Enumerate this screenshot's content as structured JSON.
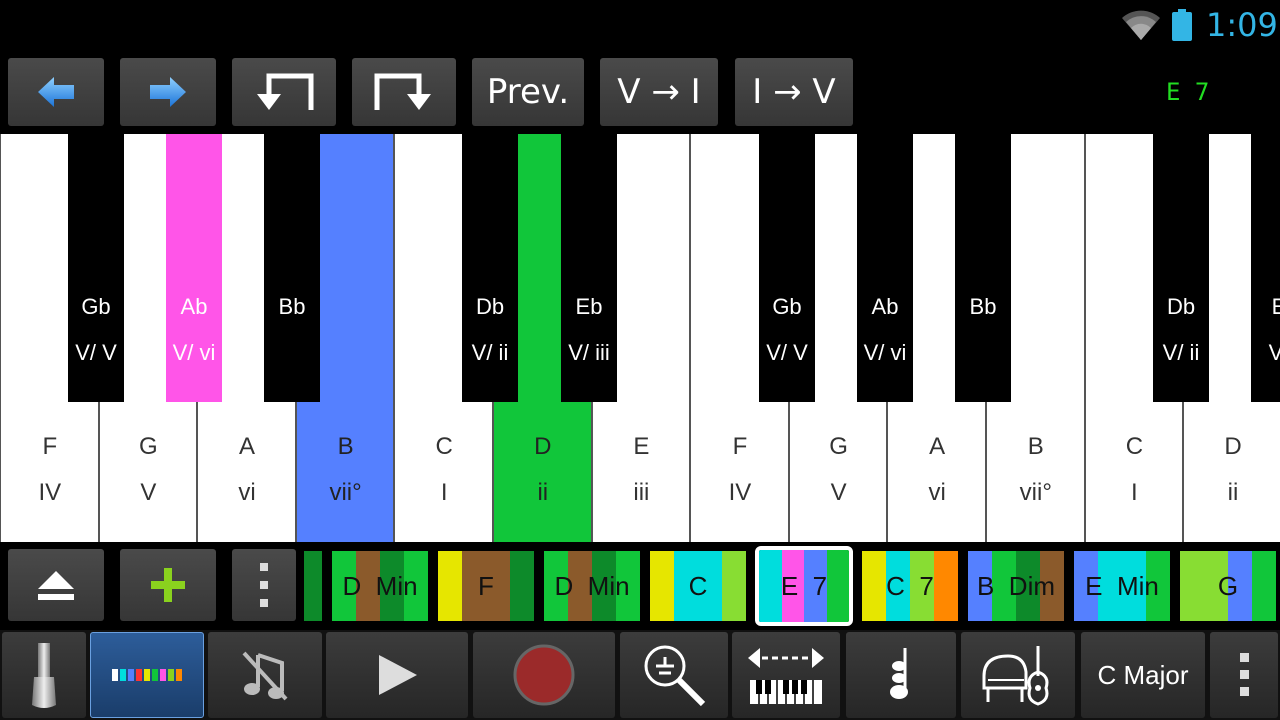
{
  "status": {
    "time": "1:09",
    "wifi_icon": "wifi-icon",
    "battery_icon": "battery-icon",
    "accent": "#33b5e5"
  },
  "toolbar": {
    "undo_icon": "arrow-left-icon",
    "redo_icon": "arrow-right-icon",
    "prev_label": "Prev.",
    "v_to_i_label": "V → I",
    "i_to_v_label": "I → V",
    "current_chord": "E 7"
  },
  "keyboard": {
    "white_keys": [
      {
        "note": "F",
        "degree": "IV"
      },
      {
        "note": "G",
        "degree": "V"
      },
      {
        "note": "A",
        "degree": "vi"
      },
      {
        "note": "B",
        "degree": "vii°",
        "highlight": "#5580ff"
      },
      {
        "note": "C",
        "degree": "I"
      },
      {
        "note": "D",
        "degree": "ii",
        "highlight": "#11c63a"
      },
      {
        "note": "E",
        "degree": "iii"
      },
      {
        "note": "F",
        "degree": "IV"
      },
      {
        "note": "G",
        "degree": "V"
      },
      {
        "note": "A",
        "degree": "vi"
      },
      {
        "note": "B",
        "degree": "vii°"
      },
      {
        "note": "C",
        "degree": "I"
      },
      {
        "note": "D",
        "degree": "ii"
      }
    ],
    "black_keys": [
      {
        "note": "Gb",
        "degree": "V/ V"
      },
      {
        "note": "Ab",
        "degree": "V/ vi",
        "highlight": "#ff55e8"
      },
      {
        "note": "Bb",
        "degree": ""
      },
      {
        "note": "Db",
        "degree": "V/ ii"
      },
      {
        "note": "Eb",
        "degree": "V/ iii"
      },
      {
        "note": "Gb",
        "degree": "V/ V"
      },
      {
        "note": "Ab",
        "degree": "V/ vi"
      },
      {
        "note": "Bb",
        "degree": ""
      },
      {
        "note": "Db",
        "degree": "V/ ii"
      },
      {
        "note": "E",
        "degree": "V/"
      }
    ]
  },
  "strip": {
    "eject_icon": "eject-icon",
    "add_icon": "plus-icon",
    "more_icon": "more-vertical-icon",
    "chords": [
      {
        "label": "",
        "colors": [
          "#0d8a2a"
        ]
      },
      {
        "label": "D  Min",
        "colors": [
          "#11c63a",
          "#8b5a2b",
          "#0d8a2a",
          "#11c63a"
        ]
      },
      {
        "label": "F",
        "colors": [
          "#e6e600",
          "#8b5a2b",
          "#8b5a2b",
          "#0d8a2a"
        ]
      },
      {
        "label": "D  Min",
        "colors": [
          "#11c63a",
          "#8b5a2b",
          "#0d8a2a",
          "#11c63a"
        ]
      },
      {
        "label": "C",
        "colors": [
          "#e6e600",
          "#00dddd",
          "#00dddd",
          "#88dd33"
        ]
      },
      {
        "label": "E  7",
        "colors": [
          "#00dddd",
          "#ff55e8",
          "#5580ff",
          "#11c63a"
        ],
        "selected": true
      },
      {
        "label": "C  7",
        "colors": [
          "#e6e600",
          "#00dddd",
          "#88dd33",
          "#ff8800"
        ]
      },
      {
        "label": "B  Dim",
        "colors": [
          "#5580ff",
          "#11c63a",
          "#0d8a2a",
          "#8b5a2b"
        ]
      },
      {
        "label": "E  Min",
        "colors": [
          "#5580ff",
          "#00dddd",
          "#00dddd",
          "#11c63a"
        ]
      },
      {
        "label": "G",
        "colors": [
          "#88dd33",
          "#88dd33",
          "#5580ff",
          "#11c63a"
        ]
      }
    ]
  },
  "bottom": {
    "sustain_icon": "sustain-pedal-icon",
    "color_mode_icon": "color-keys-icon",
    "mute_icon": "mute-notes-icon",
    "play_icon": "play-icon",
    "record_icon": "record-icon",
    "zoom_icon": "zoom-icon",
    "scroll_keys_icon": "scroll-keyboard-icon",
    "rhythm_icon": "quarter-note-icon",
    "instrument_icon": "piano-guitar-icon",
    "key_label": "C Major",
    "menu_icon": "overflow-menu-icon"
  }
}
